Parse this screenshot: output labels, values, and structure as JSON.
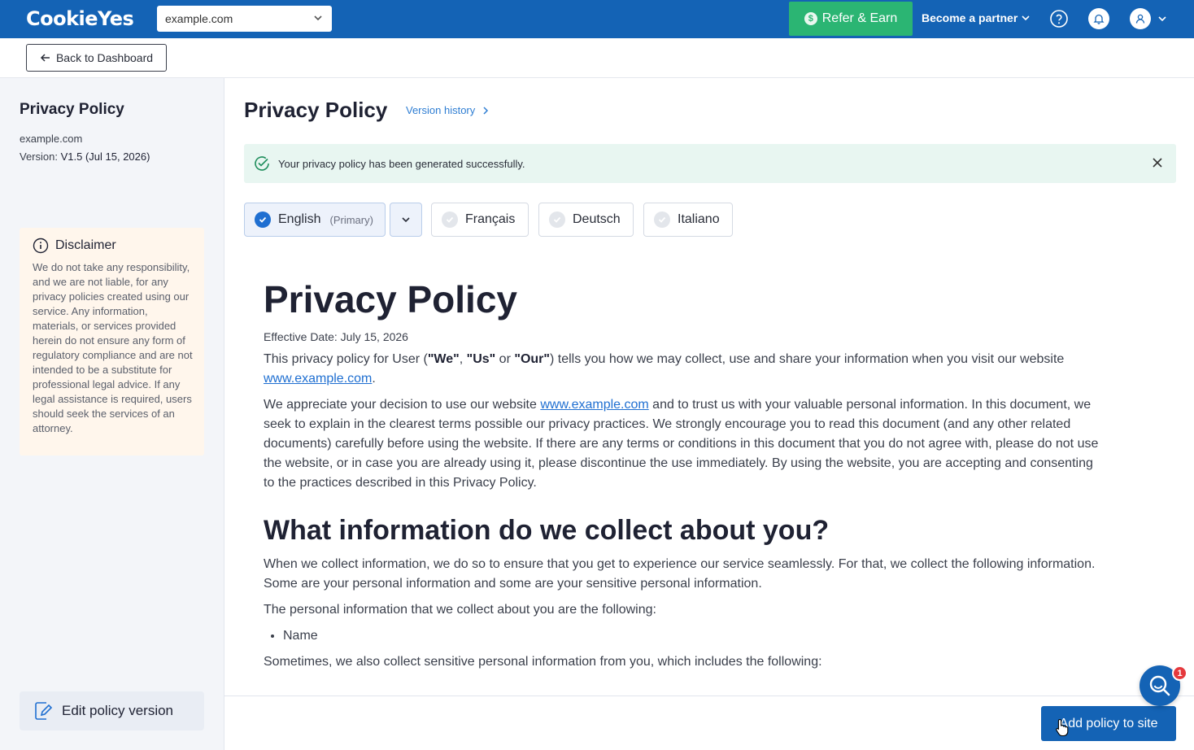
{
  "header": {
    "logo": "CookieYes",
    "site_selector": "example.com",
    "refer_label": "Refer & Earn",
    "partner_label": "Become a partner"
  },
  "subbar": {
    "back_label": "Back to Dashboard"
  },
  "sidebar": {
    "title": "Privacy Policy",
    "site": "example.com",
    "version_prefix": "Version:",
    "version_value": "V1.5 (Jul 15, 2026)",
    "disclaimer_title": "Disclaimer",
    "disclaimer_text": "We do not take any responsibility, and we are not liable, for any privacy policies created using our service. Any information, materials, or services provided herein do not ensure any form of regulatory compliance and are not intended to be a substitute for professional legal advice. If any legal assistance is required, users should seek the services of an attorney.",
    "edit_label": "Edit policy version"
  },
  "main": {
    "title": "Privacy Policy",
    "version_history": "Version history",
    "alert": "Your privacy policy has been generated successfully.",
    "languages": [
      {
        "label": "English",
        "tag": "(Primary)"
      },
      {
        "label": "Français"
      },
      {
        "label": "Deutsch"
      },
      {
        "label": "Italiano"
      }
    ]
  },
  "doc": {
    "h1": "Privacy Policy",
    "effective": "Effective Date: July 15, 2026",
    "p1_a": "This privacy policy for User (",
    "p1_we": "\"We\"",
    "p1_sep1": ", ",
    "p1_us": "\"Us\"",
    "p1_or": " or ",
    "p1_our": "\"Our\"",
    "p1_b": ") tells you how we may collect, use and share your information when you visit our website ",
    "p1_link": "www.example.com",
    "p1_end": ".",
    "p2_a": "We appreciate your decision to use our website ",
    "p2_link": "www.example.com",
    "p2_b": " and to trust us with your valuable personal information. In this document, we seek to explain in the clearest terms possible our privacy practices. We strongly encourage you to read this document (and any other related documents) carefully before using the website. If there are any terms or conditions in this document that you do not agree with, please do not use the website, or in case you are already using it, please discontinue the use immediately. By using the website, you are accepting and consenting to the practices described in this Privacy Policy.",
    "h2": "What information do we collect about you?",
    "p3": "When we collect information, we do so to ensure that you get to experience our service seamlessly. For that, we collect the following information. Some are your personal information and some are your sensitive personal information.",
    "p4": "The personal information that we collect about you are the following:",
    "li1": "Name",
    "p5": "Sometimes, we also collect sensitive personal information from you, which includes the following:"
  },
  "footer": {
    "add_label": "Add policy to site"
  },
  "chat": {
    "badge": "1"
  },
  "colors": {
    "brand": "#1463b5",
    "success": "#2bb573",
    "link": "#1f6fd1",
    "alert_bg": "#e8f6f1",
    "disclaimer_bg": "#fff6ec"
  }
}
